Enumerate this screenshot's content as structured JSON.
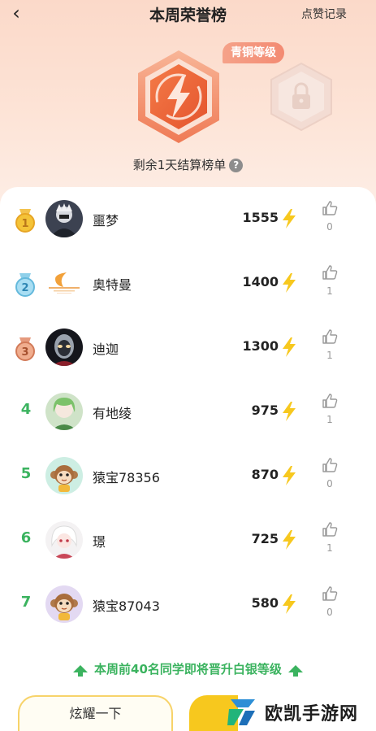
{
  "header": {
    "title": "本周荣誉榜",
    "likes_record": "点赞记录",
    "back_icon": "chevron-left-icon"
  },
  "hero": {
    "level_label": "青铜等级",
    "settle_text": "剩余1天结算榜单",
    "help_icon": "?"
  },
  "colors": {
    "accent_green": "#3bb35f",
    "bolt_yellow": "#f7c81e",
    "badge_orange": "#f26b3a"
  },
  "ranking": [
    {
      "rank": "1",
      "name": "噩梦",
      "score": "1555",
      "likes": "0",
      "medal": "gold"
    },
    {
      "rank": "2",
      "name": "奥特曼",
      "score": "1400",
      "likes": "1",
      "medal": "silver"
    },
    {
      "rank": "3",
      "name": "迪迦",
      "score": "1300",
      "likes": "1",
      "medal": "bronze"
    },
    {
      "rank": "4",
      "name": "有地绫",
      "score": "975",
      "likes": "1"
    },
    {
      "rank": "5",
      "name": "猿宝78356",
      "score": "870",
      "likes": "0"
    },
    {
      "rank": "6",
      "name": "璟",
      "score": "725",
      "likes": "1"
    },
    {
      "rank": "7",
      "name": "猿宝87043",
      "score": "580",
      "likes": "0"
    }
  ],
  "footer": {
    "promo_text": "本周前40名同学即将晋升白银等级",
    "show_off_label": "炫耀一下",
    "watermark": "欧凯手游网"
  }
}
